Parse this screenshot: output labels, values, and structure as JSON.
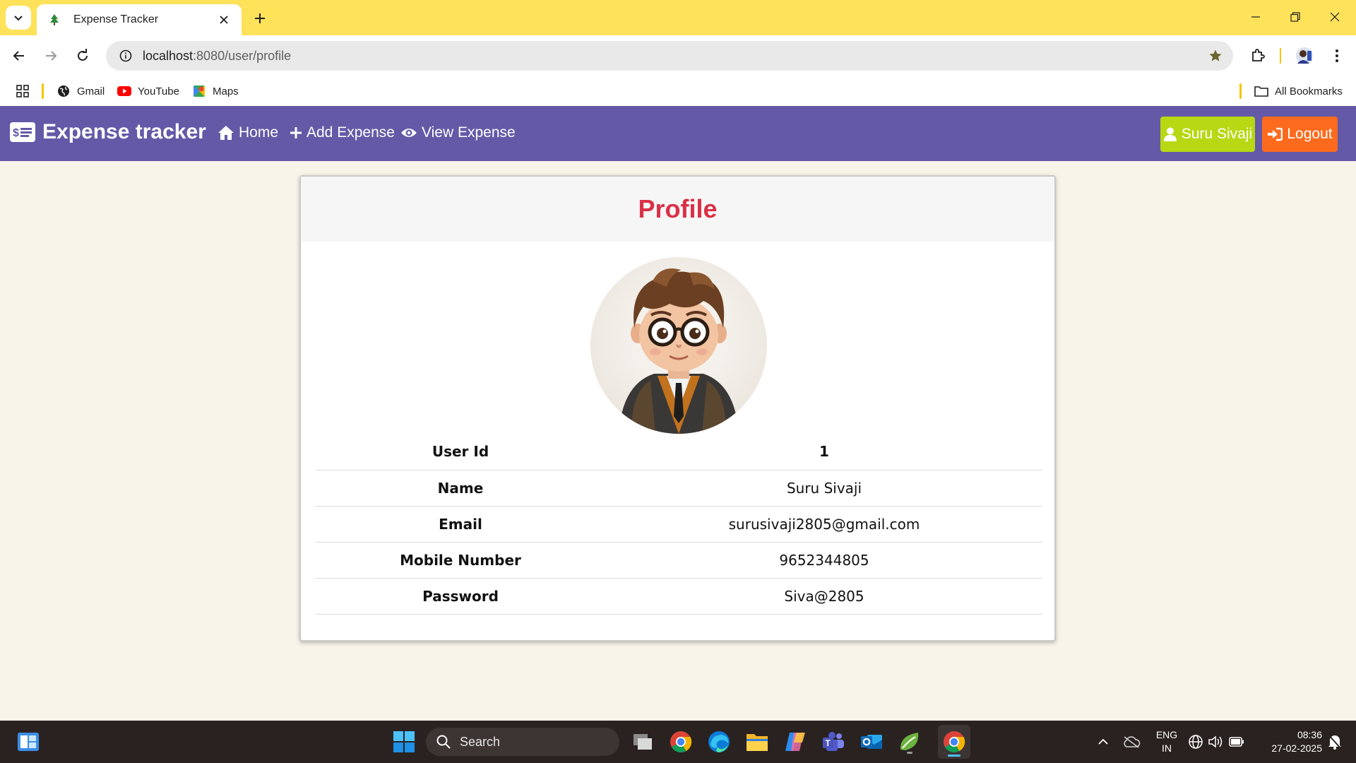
{
  "browser": {
    "tab_title": "Expense Tracker",
    "url_host": "localhost",
    "url_path": ":8080/user/profile",
    "bookmarks": [
      {
        "label": "Gmail"
      },
      {
        "label": "YouTube"
      },
      {
        "label": "Maps"
      }
    ],
    "all_bookmarks_label": "All Bookmarks"
  },
  "navbar": {
    "brand": "Expense tracker",
    "links": [
      {
        "label": "Home",
        "icon": "home-icon"
      },
      {
        "label": "Add Expense",
        "icon": "plus-icon"
      },
      {
        "label": "View Expense",
        "icon": "eye-icon"
      }
    ],
    "user_button": "Suru Sivaji",
    "logout_button": "Logout",
    "colors": {
      "bar": "#6459a7",
      "user": "#b7d813",
      "logout": "#fc6b1d"
    }
  },
  "profile": {
    "title": "Profile",
    "rows": [
      {
        "label": "User Id",
        "value": "1"
      },
      {
        "label": "Name",
        "value": "Suru Sivaji"
      },
      {
        "label": "Email",
        "value": "surusivaji2805@gmail.com"
      },
      {
        "label": "Mobile Number",
        "value": "9652344805"
      },
      {
        "label": "Password",
        "value": "Siva@2805"
      }
    ]
  },
  "taskbar": {
    "search_placeholder": "Search",
    "lang_top": "ENG",
    "lang_bottom": "IN",
    "time": "08:36",
    "date": "27-02-2025"
  }
}
